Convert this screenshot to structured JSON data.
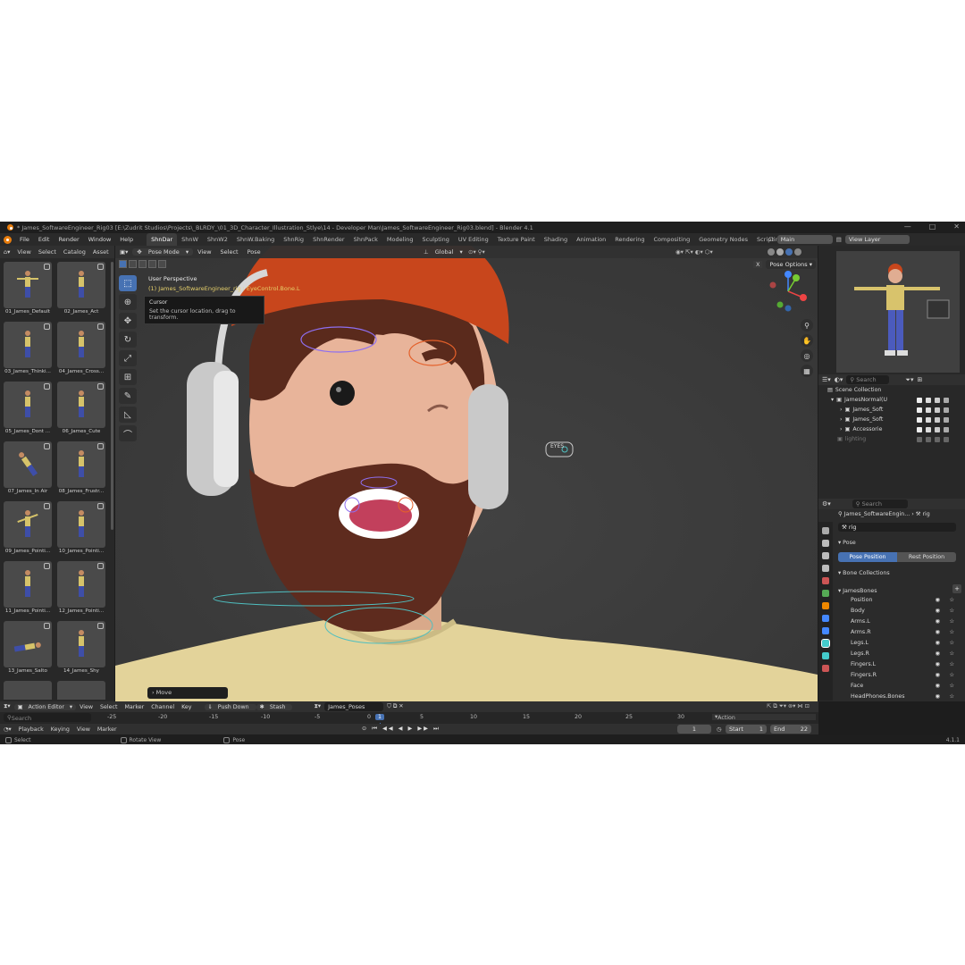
{
  "window": {
    "title": "* James_SoftwareEngineer_Rig03 [E:\\Zudrit Studios\\Projects\\_BLRDY_\\01_3D_Character_Illustration_Stlye\\14 - Developer Man\\James_SoftwareEngineer_Rig03.blend] - Blender 4.1"
  },
  "menu": [
    "File",
    "Edit",
    "Render",
    "Window",
    "Help"
  ],
  "workspaces": [
    "ShnDar",
    "ShnW",
    "ShnW2",
    "ShnW.Baking",
    "ShnRig",
    "ShnRender",
    "ShnPack",
    "Modeling",
    "Sculpting",
    "UV Editing",
    "Texture Paint",
    "Shading",
    "Animation",
    "Rendering",
    "Compositing",
    "Geometry Nodes",
    "Scripting"
  ],
  "active_workspace": "ShnDar",
  "scene_name": "Main",
  "view_layer": "View Layer",
  "asset_browser": {
    "menu": [
      "View",
      "Select",
      "Catalog",
      "Asset"
    ],
    "assets": [
      "01_James_Default",
      "02_James_Act",
      "03_James_Thinki...",
      "04_James_Cross...",
      "05_James_Dont ...",
      "06_James_Cute",
      "07_James_In Air",
      "08_James_Frustr...",
      "09_James_Pointi...",
      "10_James_Pointi...",
      "11_James_Pointi...",
      "12_James_Pointi...",
      "13_James_Salto",
      "14_James_Shy"
    ]
  },
  "viewport": {
    "mode": "Pose Mode",
    "menu": [
      "View",
      "Select",
      "Pose"
    ],
    "orientation": "Global",
    "pose_options": "Pose Options",
    "view_name": "User Perspective",
    "active_object": "(1) James_SoftwareEngineer_rig : EyeControl.Bone.L",
    "tooltip_title": "Cursor",
    "tooltip_desc": "Set the cursor location, drag to transform.",
    "last_op": "Move",
    "eyes_label": "EYES"
  },
  "outliner": {
    "search_placeholder": "Search",
    "root": "Scene Collection",
    "items": [
      {
        "name": "JamesNormal(U",
        "indent": 1
      },
      {
        "name": "James_Soft",
        "indent": 2
      },
      {
        "name": "James_Soft",
        "indent": 2
      },
      {
        "name": "Accessorie",
        "indent": 2
      },
      {
        "name": "lighting",
        "indent": 1
      }
    ]
  },
  "properties": {
    "search_placeholder": "Search",
    "breadcrumb_object": "James_SoftwareEngin...",
    "breadcrumb_data": "rig",
    "data_name": "rig",
    "pose_section": "Pose",
    "pose_position": "Pose Position",
    "rest_position": "Rest Position",
    "bone_collections_section": "Bone Collections",
    "collection_root": "JamesBones",
    "bone_collections": [
      "Position",
      "Body",
      "Arms.L",
      "Arms.R",
      "Legs.L",
      "Legs.R",
      "Fingers.L",
      "Fingers.R",
      "Face",
      "HeadPhones.Bones"
    ]
  },
  "dopesheet": {
    "editor": "Action Editor",
    "menu": [
      "View",
      "Select",
      "Marker",
      "Channel",
      "Key"
    ],
    "push_down": "Push Down",
    "stash": "Stash",
    "action_name": "James_Poses",
    "search_placeholder": "Search",
    "ruler": [
      "-25",
      "-20",
      "-15",
      "-10",
      "-5",
      "0",
      "1",
      "5",
      "10",
      "15",
      "20",
      "25",
      "30"
    ],
    "channel": "Action"
  },
  "timeline": {
    "menu": [
      "Playback",
      "Keying",
      "View",
      "Marker"
    ],
    "current_frame": "1",
    "start_label": "Start",
    "start": "1",
    "end_label": "End",
    "end": "22"
  },
  "status": {
    "left": "Select",
    "mid": "Rotate View",
    "right": "Pose",
    "version": "4.1.1"
  },
  "colors": {
    "accent": "#4772b3",
    "bg": "#1d1d1d",
    "viewport": "#3d3d3d",
    "active_text": "#e7d06a"
  }
}
